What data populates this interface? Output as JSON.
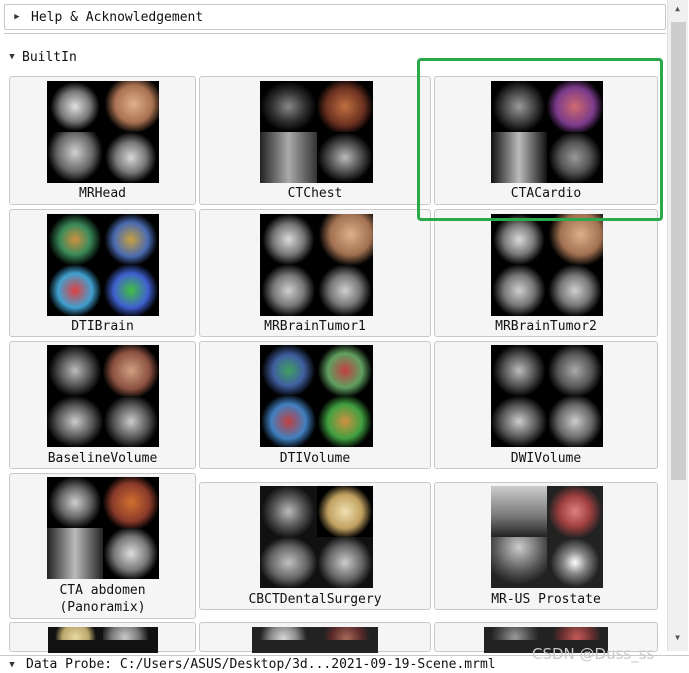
{
  "help_section": {
    "label": "Help & Acknowledgement",
    "expanded": false
  },
  "builtin_section": {
    "label": "BuiltIn",
    "expanded": true
  },
  "samples": [
    {
      "label": "MRHead"
    },
    {
      "label": "CTChest"
    },
    {
      "label": "CTACardio"
    },
    {
      "label": "DTIBrain"
    },
    {
      "label": "MRBrainTumor1"
    },
    {
      "label": "MRBrainTumor2"
    },
    {
      "label": "BaselineVolume"
    },
    {
      "label": "DTIVolume"
    },
    {
      "label": "DWIVolume"
    },
    {
      "label": "CTA abdomen\n(Panoramix)"
    },
    {
      "label": "CBCTDentalSurgery"
    },
    {
      "label": "MR-US Prostate"
    }
  ],
  "data_probe": {
    "label": "Data Probe: C:/Users/ASUS/Desktop/3d...2021-09-19-Scene.mrml"
  },
  "watermark": {
    "text": "CSDN @Duss_ss"
  },
  "highlight": {
    "color": "#2aa84a",
    "target": "CTACardio"
  }
}
